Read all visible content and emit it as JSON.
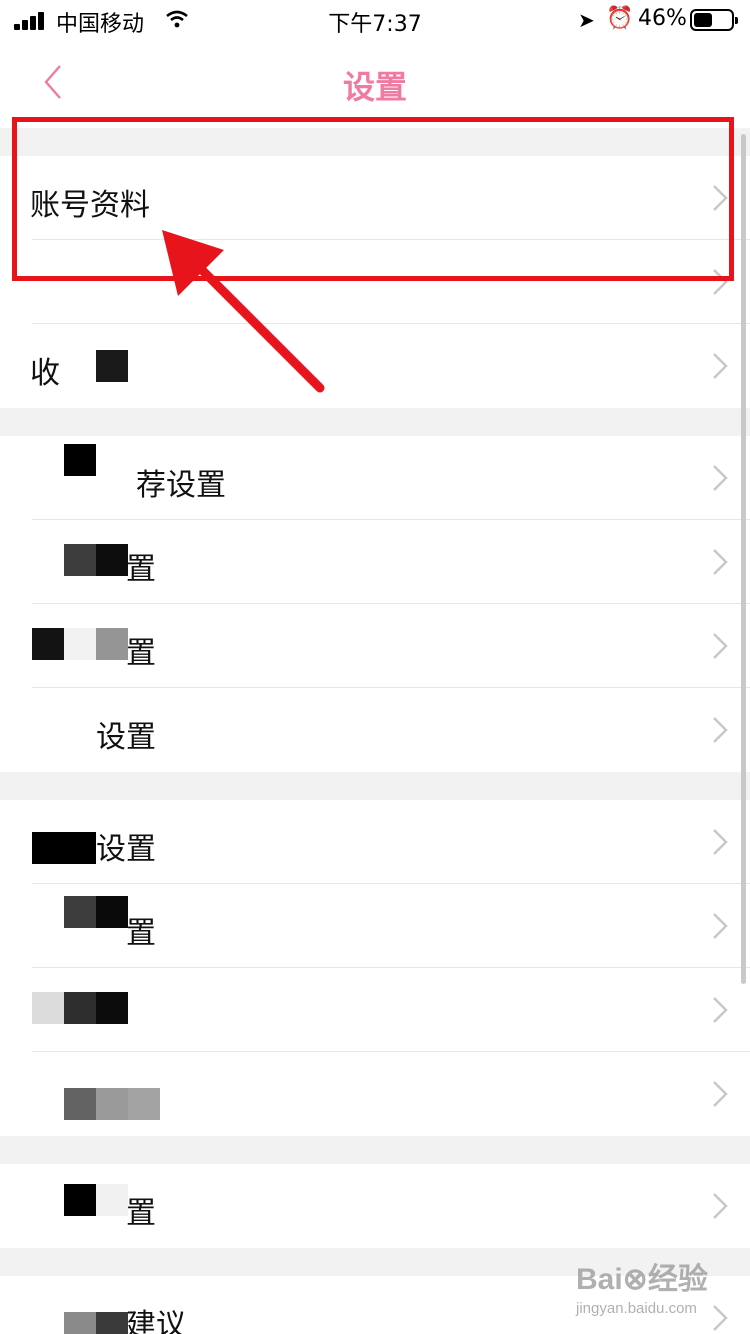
{
  "status_bar": {
    "carrier": "中国移动",
    "time": "下午7:37",
    "battery_percent": "46%",
    "icons": [
      "signal-icon",
      "wifi-icon",
      "location-icon",
      "alarm-icon",
      "battery-icon"
    ]
  },
  "nav": {
    "title": "设置",
    "back_icon": "chevron-left-icon",
    "title_color": "#ef7ba3"
  },
  "rows": [
    {
      "label": "账号资料"
    },
    {
      "label": ""
    },
    {
      "label": "收"
    },
    {
      "label": "荐设置"
    },
    {
      "label": "置"
    },
    {
      "label": "置"
    },
    {
      "label": "设置"
    },
    {
      "label": "设置"
    },
    {
      "label": "置"
    },
    {
      "label": ""
    },
    {
      "label": ""
    },
    {
      "label": "置"
    },
    {
      "label": "建议"
    }
  ],
  "annotation": {
    "box_color": "#e8141c"
  },
  "watermark": {
    "main": "Bai⊗经验",
    "sub": "jingyan.baidu.com"
  }
}
